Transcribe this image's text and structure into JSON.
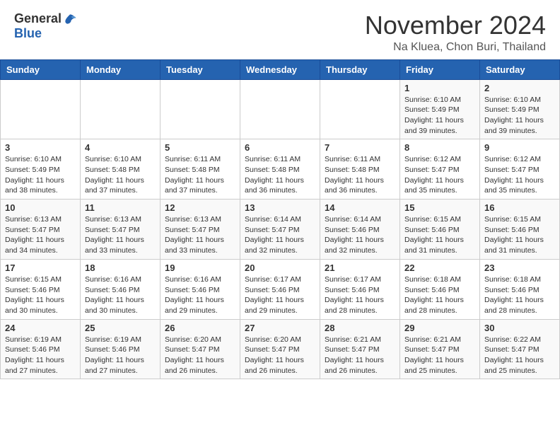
{
  "logo": {
    "general": "General",
    "blue": "Blue"
  },
  "title": "November 2024",
  "location": "Na Kluea, Chon Buri, Thailand",
  "days_of_week": [
    "Sunday",
    "Monday",
    "Tuesday",
    "Wednesday",
    "Thursday",
    "Friday",
    "Saturday"
  ],
  "weeks": [
    [
      {
        "day": "",
        "info": ""
      },
      {
        "day": "",
        "info": ""
      },
      {
        "day": "",
        "info": ""
      },
      {
        "day": "",
        "info": ""
      },
      {
        "day": "",
        "info": ""
      },
      {
        "day": "1",
        "info": "Sunrise: 6:10 AM\nSunset: 5:49 PM\nDaylight: 11 hours\nand 39 minutes."
      },
      {
        "day": "2",
        "info": "Sunrise: 6:10 AM\nSunset: 5:49 PM\nDaylight: 11 hours\nand 39 minutes."
      }
    ],
    [
      {
        "day": "3",
        "info": "Sunrise: 6:10 AM\nSunset: 5:49 PM\nDaylight: 11 hours\nand 38 minutes."
      },
      {
        "day": "4",
        "info": "Sunrise: 6:10 AM\nSunset: 5:48 PM\nDaylight: 11 hours\nand 37 minutes."
      },
      {
        "day": "5",
        "info": "Sunrise: 6:11 AM\nSunset: 5:48 PM\nDaylight: 11 hours\nand 37 minutes."
      },
      {
        "day": "6",
        "info": "Sunrise: 6:11 AM\nSunset: 5:48 PM\nDaylight: 11 hours\nand 36 minutes."
      },
      {
        "day": "7",
        "info": "Sunrise: 6:11 AM\nSunset: 5:48 PM\nDaylight: 11 hours\nand 36 minutes."
      },
      {
        "day": "8",
        "info": "Sunrise: 6:12 AM\nSunset: 5:47 PM\nDaylight: 11 hours\nand 35 minutes."
      },
      {
        "day": "9",
        "info": "Sunrise: 6:12 AM\nSunset: 5:47 PM\nDaylight: 11 hours\nand 35 minutes."
      }
    ],
    [
      {
        "day": "10",
        "info": "Sunrise: 6:13 AM\nSunset: 5:47 PM\nDaylight: 11 hours\nand 34 minutes."
      },
      {
        "day": "11",
        "info": "Sunrise: 6:13 AM\nSunset: 5:47 PM\nDaylight: 11 hours\nand 33 minutes."
      },
      {
        "day": "12",
        "info": "Sunrise: 6:13 AM\nSunset: 5:47 PM\nDaylight: 11 hours\nand 33 minutes."
      },
      {
        "day": "13",
        "info": "Sunrise: 6:14 AM\nSunset: 5:47 PM\nDaylight: 11 hours\nand 32 minutes."
      },
      {
        "day": "14",
        "info": "Sunrise: 6:14 AM\nSunset: 5:46 PM\nDaylight: 11 hours\nand 32 minutes."
      },
      {
        "day": "15",
        "info": "Sunrise: 6:15 AM\nSunset: 5:46 PM\nDaylight: 11 hours\nand 31 minutes."
      },
      {
        "day": "16",
        "info": "Sunrise: 6:15 AM\nSunset: 5:46 PM\nDaylight: 11 hours\nand 31 minutes."
      }
    ],
    [
      {
        "day": "17",
        "info": "Sunrise: 6:15 AM\nSunset: 5:46 PM\nDaylight: 11 hours\nand 30 minutes."
      },
      {
        "day": "18",
        "info": "Sunrise: 6:16 AM\nSunset: 5:46 PM\nDaylight: 11 hours\nand 30 minutes."
      },
      {
        "day": "19",
        "info": "Sunrise: 6:16 AM\nSunset: 5:46 PM\nDaylight: 11 hours\nand 29 minutes."
      },
      {
        "day": "20",
        "info": "Sunrise: 6:17 AM\nSunset: 5:46 PM\nDaylight: 11 hours\nand 29 minutes."
      },
      {
        "day": "21",
        "info": "Sunrise: 6:17 AM\nSunset: 5:46 PM\nDaylight: 11 hours\nand 28 minutes."
      },
      {
        "day": "22",
        "info": "Sunrise: 6:18 AM\nSunset: 5:46 PM\nDaylight: 11 hours\nand 28 minutes."
      },
      {
        "day": "23",
        "info": "Sunrise: 6:18 AM\nSunset: 5:46 PM\nDaylight: 11 hours\nand 28 minutes."
      }
    ],
    [
      {
        "day": "24",
        "info": "Sunrise: 6:19 AM\nSunset: 5:46 PM\nDaylight: 11 hours\nand 27 minutes."
      },
      {
        "day": "25",
        "info": "Sunrise: 6:19 AM\nSunset: 5:46 PM\nDaylight: 11 hours\nand 27 minutes."
      },
      {
        "day": "26",
        "info": "Sunrise: 6:20 AM\nSunset: 5:47 PM\nDaylight: 11 hours\nand 26 minutes."
      },
      {
        "day": "27",
        "info": "Sunrise: 6:20 AM\nSunset: 5:47 PM\nDaylight: 11 hours\nand 26 minutes."
      },
      {
        "day": "28",
        "info": "Sunrise: 6:21 AM\nSunset: 5:47 PM\nDaylight: 11 hours\nand 26 minutes."
      },
      {
        "day": "29",
        "info": "Sunrise: 6:21 AM\nSunset: 5:47 PM\nDaylight: 11 hours\nand 25 minutes."
      },
      {
        "day": "30",
        "info": "Sunrise: 6:22 AM\nSunset: 5:47 PM\nDaylight: 11 hours\nand 25 minutes."
      }
    ]
  ],
  "colors": {
    "header_bg": "#2563b0",
    "header_text": "#ffffff",
    "border": "#cccccc",
    "odd_row": "#f9f9f9",
    "even_row": "#ffffff"
  }
}
